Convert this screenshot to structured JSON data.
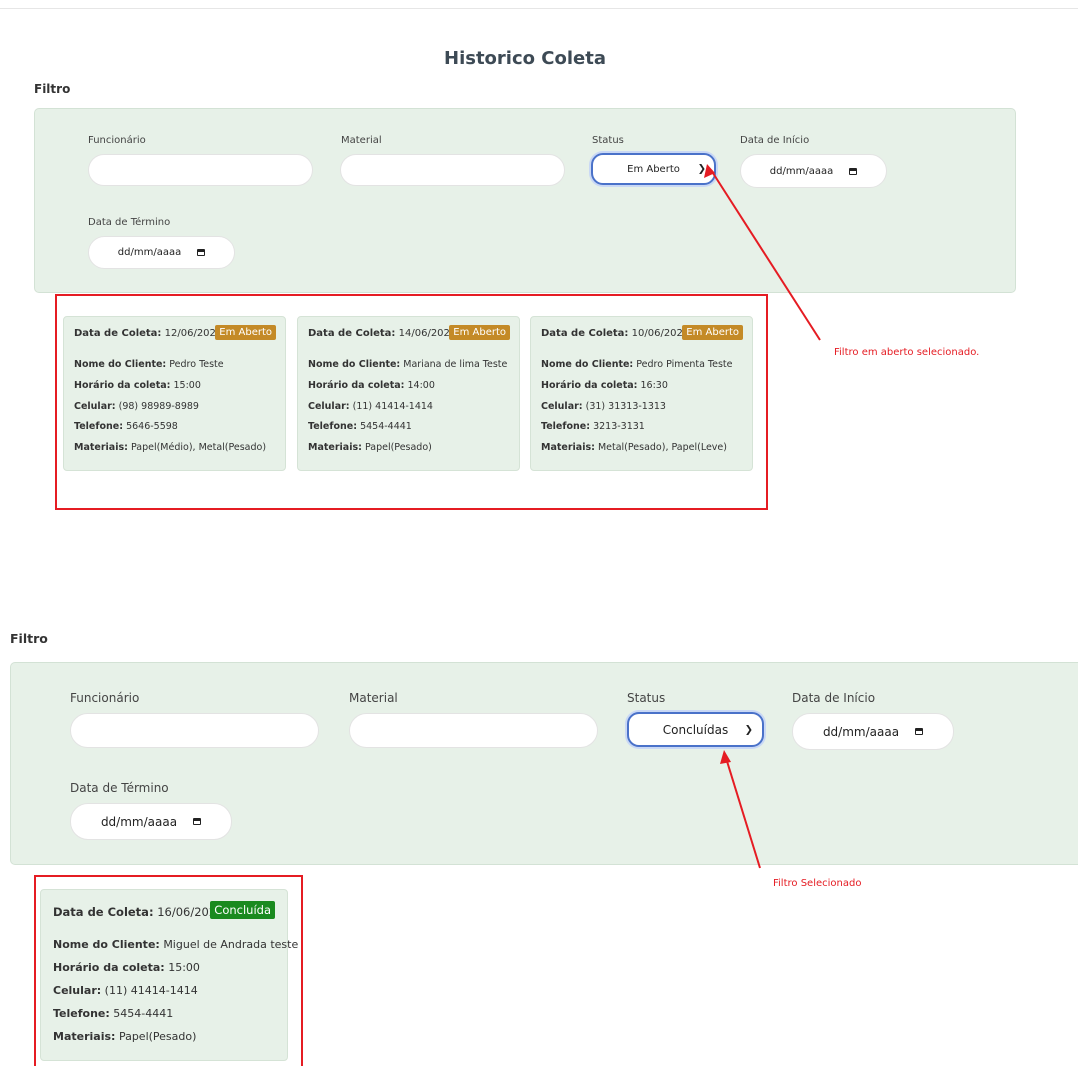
{
  "page_title": "Historico Coleta",
  "filter_title": "Filtro",
  "filters": {
    "employee_label": "Funcionário",
    "material_label": "Material",
    "status_label": "Status",
    "start_date_label": "Data de Início",
    "end_date_label": "Data de Término",
    "date_placeholder": "dd/mm/aaaa"
  },
  "first_screen": {
    "status_selected": "Em Aberto",
    "annotation": "Filtro em aberto selecionado.",
    "cards": [
      {
        "date_label": "Data de Coleta:",
        "date": "12/06/2024",
        "status": "Em Aberto",
        "client_label": "Nome do Cliente:",
        "client": "Pedro Teste",
        "time_label": "Horário da coleta:",
        "time": "15:00",
        "mobile_label": "Celular:",
        "mobile": "(98) 98989-8989",
        "phone_label": "Telefone:",
        "phone": "5646-5598",
        "materials_label": "Materiais:",
        "materials": "Papel(Médio), Metal(Pesado)"
      },
      {
        "date_label": "Data de Coleta:",
        "date": "14/06/2024",
        "status": "Em Aberto",
        "client_label": "Nome do Cliente:",
        "client": "Mariana de lima Teste",
        "time_label": "Horário da coleta:",
        "time": "14:00",
        "mobile_label": "Celular:",
        "mobile": "(11) 41414-1414",
        "phone_label": "Telefone:",
        "phone": "5454-4441",
        "materials_label": "Materiais:",
        "materials": "Papel(Pesado)"
      },
      {
        "date_label": "Data de Coleta:",
        "date": "10/06/2024",
        "status": "Em Aberto",
        "client_label": "Nome do Cliente:",
        "client": "Pedro Pimenta Teste",
        "time_label": "Horário da coleta:",
        "time": "16:30",
        "mobile_label": "Celular:",
        "mobile": "(31) 31313-1313",
        "phone_label": "Telefone:",
        "phone": "3213-3131",
        "materials_label": "Materiais:",
        "materials": "Metal(Pesado), Papel(Leve)"
      }
    ]
  },
  "second_screen": {
    "status_selected": "Concluídas",
    "annotation": "Filtro Selecionado",
    "cards": [
      {
        "date_label": "Data de Coleta:",
        "date": "16/06/2024",
        "status": "Concluída",
        "client_label": "Nome do Cliente:",
        "client": "Miguel de Andrada teste",
        "time_label": "Horário da coleta:",
        "time": "15:00",
        "mobile_label": "Celular:",
        "mobile": "(11) 41414-1414",
        "phone_label": "Telefone:",
        "phone": "5454-4441",
        "materials_label": "Materiais:",
        "materials": "Papel(Pesado)"
      }
    ]
  },
  "colors": {
    "panel_bg": "#e7f1e8",
    "highlight_red": "#e51c23",
    "open_badge": "#c48a27",
    "done_badge": "#1a8a1f",
    "focus_blue": "#4a72c9"
  }
}
